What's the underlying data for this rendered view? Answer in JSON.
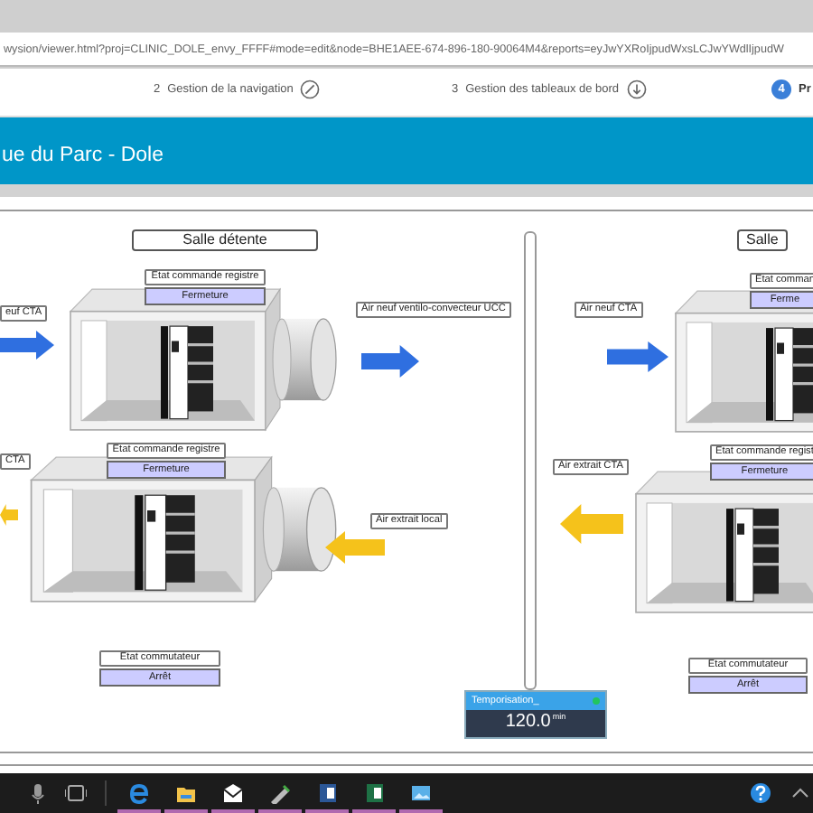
{
  "browser": {
    "url": "wysion/viewer.html?proj=CLINIC_DOLE_envy_FFFF#mode=edit&node=BHE1AEE-674-896-180-90064M4&reports=eyJwYXRoIjpudWxsLCJwYWdlIjpudW"
  },
  "steps": [
    {
      "number": "2",
      "label": "Gestion de la navigation",
      "selected": false
    },
    {
      "number": "3",
      "label": "Gestion des tableaux de bord",
      "selected": false
    },
    {
      "number": "4",
      "label": "Pr",
      "selected": true
    }
  ],
  "header": {
    "title": "ue du Parc - Dole"
  },
  "diagram": {
    "rooms": [
      {
        "title": "Salle détente"
      },
      {
        "title": "Salle"
      }
    ],
    "registers": [
      {
        "caption": "Etat commande registre",
        "value": "Fermeture"
      },
      {
        "caption": "Etat commande registre",
        "value": "Fermeture"
      },
      {
        "caption": "Etat comman",
        "value": "Ferme"
      },
      {
        "caption": "Etat commande regist",
        "value": "Fermeture"
      },
      {
        "caption": "Etat commutateur",
        "value": "Arrêt"
      },
      {
        "caption": "Etat commutateur",
        "value": "Arrêt"
      }
    ],
    "labels": [
      "euf CTA",
      "Air neuf ventilo-convecteur UCC",
      "CTA",
      "Air extrait local",
      "Air neuf CTA",
      "Air extrait CTA"
    ],
    "arrows": [
      {
        "color": "#2f6fe0",
        "kind": "supply"
      },
      {
        "color": "#2f6fe0",
        "kind": "supply"
      },
      {
        "color": "#f5c21b",
        "kind": "exhaust"
      },
      {
        "color": "#f5c21b",
        "kind": "exhaust"
      },
      {
        "color": "#2f6fe0",
        "kind": "supply"
      },
      {
        "color": "#f5c21b",
        "kind": "exhaust"
      }
    ]
  },
  "timer": {
    "title": "Temporisation_",
    "online": true,
    "value": "120.0",
    "unit": "min"
  }
}
